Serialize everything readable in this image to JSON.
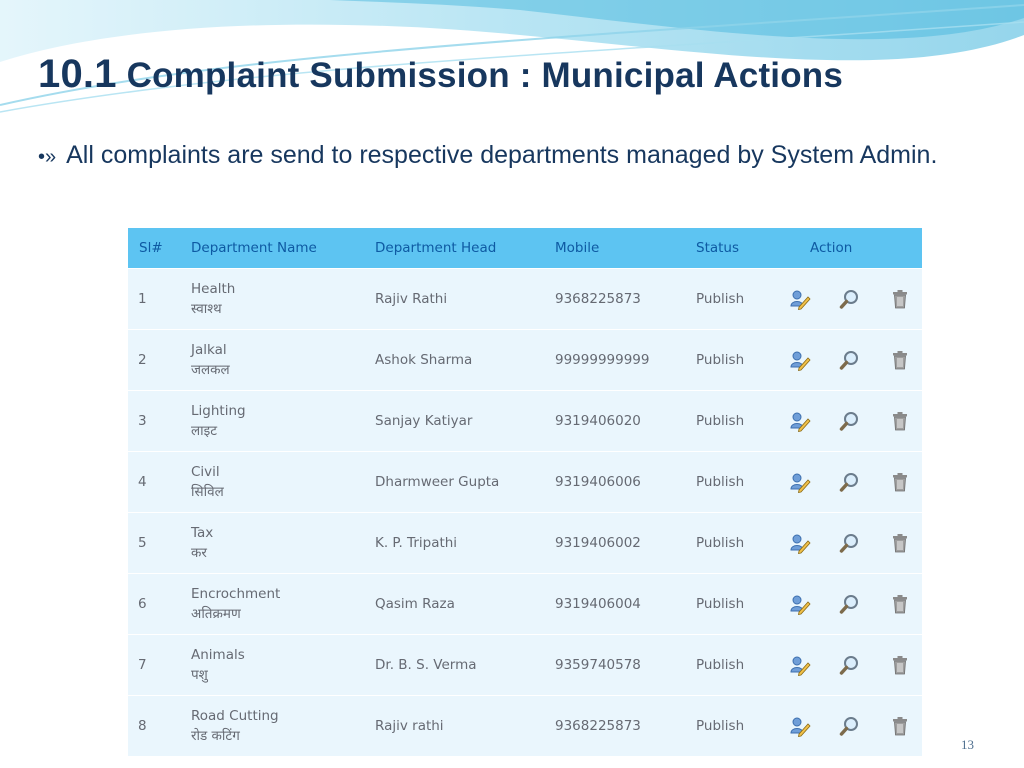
{
  "slide": {
    "title_number": "10.1",
    "title_text": "Complaint Submission : Municipal Actions",
    "bullet_marker": "•»",
    "bullet_text": "All complaints are send to respective departments managed by System Admin.",
    "page_number": "13",
    "colors": {
      "title": "#17375e",
      "header_bg": "#5dc4f2",
      "header_text": "#0e5aa3",
      "row_bg": "#eaf6fd"
    }
  },
  "table": {
    "headers": [
      "Sl#",
      "Department Name",
      "Department Head",
      "Mobile",
      "Status",
      "Action"
    ],
    "action_icons": [
      "edit-icon",
      "view-icon",
      "delete-icon"
    ],
    "rows": [
      {
        "sl": "1",
        "name": "Health",
        "name_hi": "स्वाश्थ",
        "head": "Rajiv Rathi",
        "mobile": "9368225873",
        "status": "Publish"
      },
      {
        "sl": "2",
        "name": "Jalkal",
        "name_hi": "जलकल",
        "head": "Ashok Sharma",
        "mobile": "99999999999",
        "status": "Publish"
      },
      {
        "sl": "3",
        "name": "Lighting",
        "name_hi": "लाइट",
        "head": "Sanjay Katiyar",
        "mobile": "9319406020",
        "status": "Publish"
      },
      {
        "sl": "4",
        "name": "Civil",
        "name_hi": "सिविल",
        "head": "Dharmweer Gupta",
        "mobile": "9319406006",
        "status": "Publish"
      },
      {
        "sl": "5",
        "name": "Tax",
        "name_hi": "कर",
        "head": "K. P. Tripathi",
        "mobile": "9319406002",
        "status": "Publish"
      },
      {
        "sl": "6",
        "name": "Encrochment",
        "name_hi": "अतिक्रमण",
        "head": "Qasim Raza",
        "mobile": "9319406004",
        "status": "Publish"
      },
      {
        "sl": "7",
        "name": "Animals",
        "name_hi": "पशु",
        "head": "Dr. B. S. Verma",
        "mobile": "9359740578",
        "status": "Publish"
      },
      {
        "sl": "8",
        "name": "Road Cutting",
        "name_hi": "रोड कटिंग",
        "head": "Rajiv rathi",
        "mobile": "9368225873",
        "status": "Publish"
      }
    ]
  }
}
